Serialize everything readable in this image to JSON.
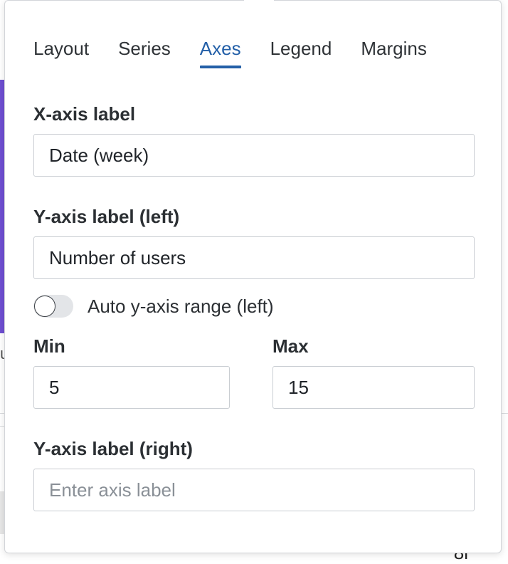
{
  "tabs": [
    {
      "label": "Layout",
      "active": false
    },
    {
      "label": "Series",
      "active": false
    },
    {
      "label": "Axes",
      "active": true
    },
    {
      "label": "Legend",
      "active": false
    },
    {
      "label": "Margins",
      "active": false
    }
  ],
  "x_axis": {
    "label": "X-axis label",
    "value": "Date (week)"
  },
  "y_axis_left": {
    "label": "Y-axis label (left)",
    "value": "Number of users"
  },
  "auto_range": {
    "label": "Auto y-axis range (left)",
    "enabled": false
  },
  "range": {
    "min_label": "Min",
    "min_value": "5",
    "max_label": "Max",
    "max_value": "15"
  },
  "y_axis_right": {
    "label": "Y-axis label (right)",
    "value": "",
    "placeholder": "Enter axis label"
  },
  "colors": {
    "accent": "#2460a8",
    "background_strip": "#6f4fd2"
  }
}
